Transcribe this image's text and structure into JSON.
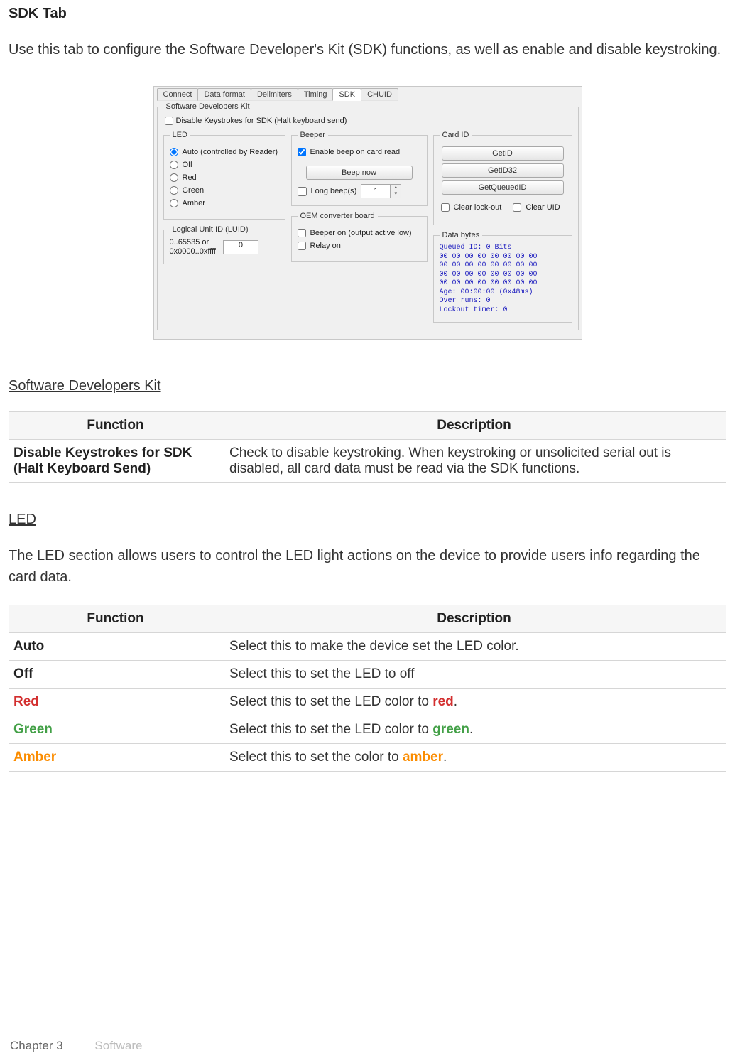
{
  "page_title": "SDK Tab",
  "intro": "Use this tab to configure the Software Developer's Kit (SDK) functions, as well as enable and disable keystroking.",
  "screenshot": {
    "tabs": [
      "Connect",
      "Data format",
      "Delimiters",
      "Timing",
      "SDK",
      "CHUID"
    ],
    "active_tab_index": 4,
    "outer_legend": "Software Developers Kit",
    "disable_keystrokes_label": "Disable Keystrokes for SDK (Halt keyboard send)",
    "led": {
      "legend": "LED",
      "options": [
        "Auto (controlled by Reader)",
        "Off",
        "Red",
        "Green",
        "Amber"
      ],
      "selected_index": 0
    },
    "luid": {
      "legend": "Logical Unit ID (LUID)",
      "range_label": "0..65535 or\n0x0000..0xffff",
      "value": "0"
    },
    "beeper": {
      "legend": "Beeper",
      "enable_label": "Enable beep on card read",
      "beep_now_label": "Beep now",
      "long_beep_label": "Long beep(s)",
      "long_beep_value": "1"
    },
    "oem": {
      "legend": "OEM converter board",
      "beeper_on_label": "Beeper on (output active low)",
      "relay_on_label": "Relay on"
    },
    "card_id": {
      "legend": "Card ID",
      "buttons": [
        "GetID",
        "GetID32",
        "GetQueuedID"
      ],
      "clear_lockout_label": "Clear lock-out",
      "clear_uid_label": "Clear UID"
    },
    "data_bytes": {
      "legend": "Data bytes",
      "lines": [
        "Queued ID: 0 Bits",
        "00 00 00 00 00 00 00 00",
        "00 00 00 00 00 00 00 00",
        "00 00 00 00 00 00 00 00",
        "00 00 00 00 00 00 00 00",
        "Age: 00:00:00 (0x48ms)",
        "Over runs: 0",
        "Lockout timer: 0"
      ]
    }
  },
  "section_sdk": {
    "heading": "Software Developers Kit",
    "table": {
      "headers": [
        "Function",
        "Description"
      ],
      "rows": [
        {
          "function": "Disable Keystrokes for SDK (Halt Keyboard Send)",
          "description": "Check to disable keystroking. When keystroking or unsolicited serial out is disabled, all card data must be read via the SDK functions."
        }
      ]
    }
  },
  "section_led": {
    "heading": "LED",
    "intro": "The LED section allows users to control the LED light actions on the device to provide users info regarding the card data.",
    "table": {
      "headers": [
        "Function",
        "Description"
      ],
      "rows": [
        {
          "function": "Auto",
          "description": "Select this to make the device set the LED color."
        },
        {
          "function": "Off",
          "description": "Select this to set the LED to off"
        },
        {
          "function": "Red",
          "description_prefix": "Select this to set the LED color to ",
          "color_word": "red",
          "description_suffix": "."
        },
        {
          "function": "Green",
          "description_prefix": "Select this to set the LED color to ",
          "color_word": "green",
          "description_suffix": "."
        },
        {
          "function": "Amber",
          "description_prefix": "Select this to set the color to ",
          "color_word": "amber",
          "description_suffix": "."
        }
      ]
    }
  },
  "footer": {
    "chapter": "Chapter 3",
    "section": "Software"
  }
}
